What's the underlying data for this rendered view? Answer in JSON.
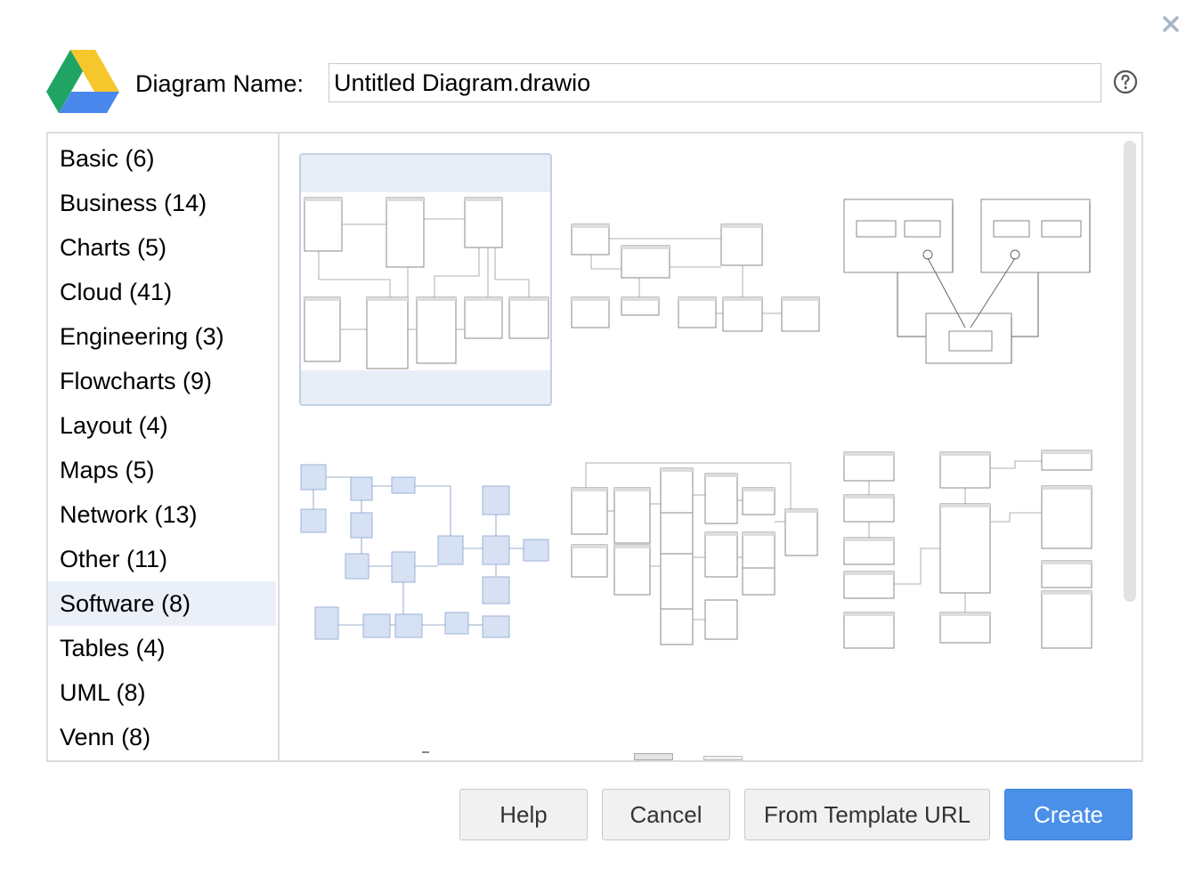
{
  "dialog": {
    "close_icon": "close-icon",
    "logo_icon": "google-drive-logo",
    "name_label": "Diagram Name:",
    "name_value": "Untitled Diagram.drawio",
    "help_icon": "help-circle-icon"
  },
  "categories": [
    {
      "label": "Basic (6)"
    },
    {
      "label": "Business (14)"
    },
    {
      "label": "Charts (5)"
    },
    {
      "label": "Cloud (41)"
    },
    {
      "label": "Engineering (3)"
    },
    {
      "label": "Flowcharts (9)"
    },
    {
      "label": "Layout (4)"
    },
    {
      "label": "Maps (5)"
    },
    {
      "label": "Network (13)"
    },
    {
      "label": "Other (11)"
    },
    {
      "label": "Software (8)",
      "selected": true
    },
    {
      "label": "Tables (4)"
    },
    {
      "label": "UML (8)"
    },
    {
      "label": "Venn (8)"
    }
  ],
  "templates": [
    {
      "name": "software-template-1",
      "selected": true
    },
    {
      "name": "software-template-2"
    },
    {
      "name": "software-template-3"
    },
    {
      "name": "software-template-4"
    },
    {
      "name": "software-template-5"
    },
    {
      "name": "software-template-6"
    }
  ],
  "buttons": {
    "help": "Help",
    "cancel": "Cancel",
    "from_template_url": "From Template URL",
    "create": "Create"
  },
  "colors": {
    "primary": "#4a90e9",
    "selection": "#ebeff8"
  }
}
